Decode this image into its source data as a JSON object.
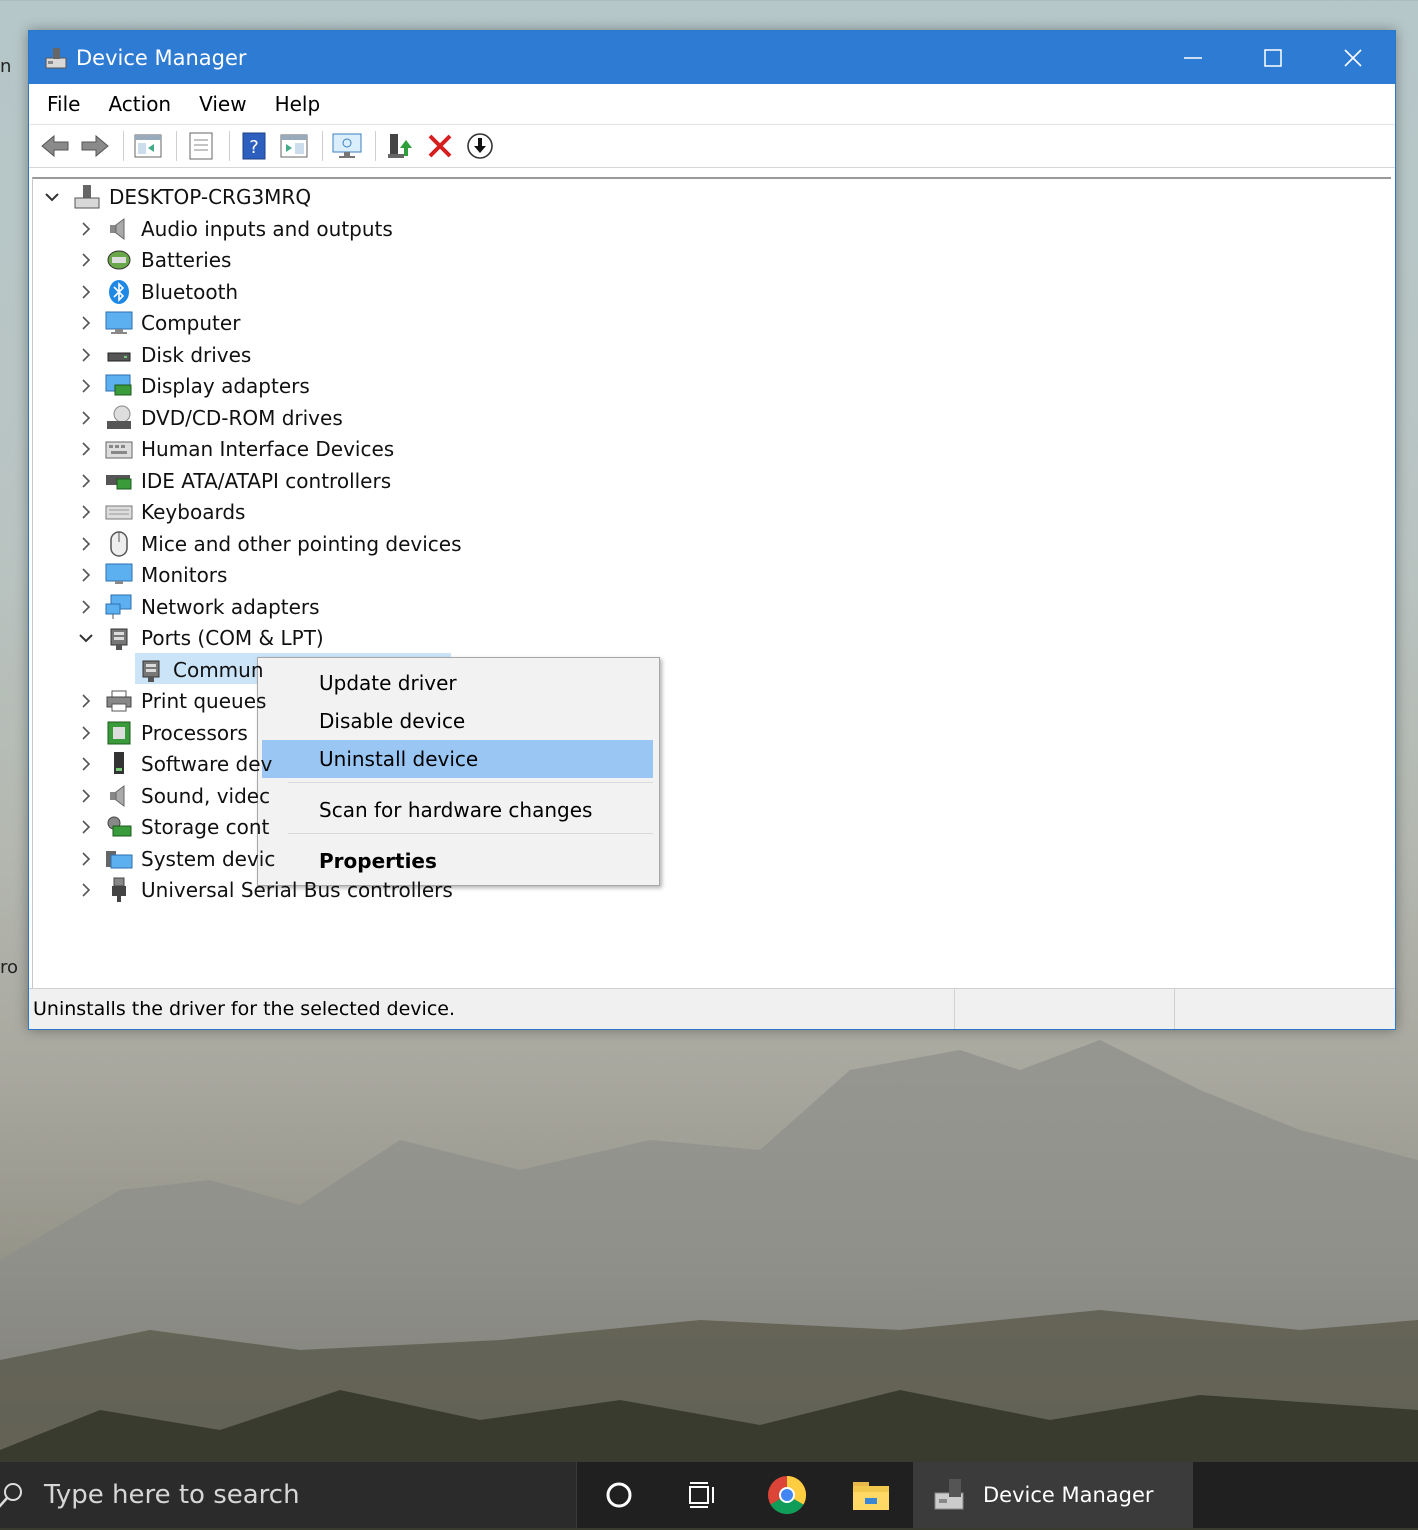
{
  "window": {
    "title": "Device Manager"
  },
  "menu": [
    "File",
    "Action",
    "View",
    "Help"
  ],
  "tree": {
    "root": "DESKTOP-CRG3MRQ",
    "categories": [
      {
        "label": "Audio inputs and outputs",
        "icon": "speaker-icon"
      },
      {
        "label": "Batteries",
        "icon": "battery-icon"
      },
      {
        "label": "Bluetooth",
        "icon": "bluetooth-icon"
      },
      {
        "label": "Computer",
        "icon": "computer-icon"
      },
      {
        "label": "Disk drives",
        "icon": "disk-drive-icon"
      },
      {
        "label": "Display adapters",
        "icon": "display-adapter-icon"
      },
      {
        "label": "DVD/CD-ROM drives",
        "icon": "dvd-drive-icon"
      },
      {
        "label": "Human Interface Devices",
        "icon": "hid-icon"
      },
      {
        "label": "IDE ATA/ATAPI controllers",
        "icon": "ide-controller-icon"
      },
      {
        "label": "Keyboards",
        "icon": "keyboard-icon"
      },
      {
        "label": "Mice and other pointing devices",
        "icon": "mouse-icon"
      },
      {
        "label": "Monitors",
        "icon": "monitor-icon"
      },
      {
        "label": "Network adapters",
        "icon": "network-adapter-icon"
      },
      {
        "label": "Ports (COM & LPT)",
        "icon": "port-icon"
      },
      {
        "label": "Commun",
        "icon": "port-icon"
      },
      {
        "label": "Print queues",
        "icon": "printer-icon"
      },
      {
        "label": "Processors",
        "icon": "processor-icon"
      },
      {
        "label": "Software dev",
        "icon": "software-device-icon"
      },
      {
        "label": "Sound, videc",
        "icon": "speaker-icon"
      },
      {
        "label": "Storage cont",
        "icon": "storage-controller-icon"
      },
      {
        "label": "System devic",
        "icon": "system-device-icon"
      },
      {
        "label": "Universal Serial Bus controllers",
        "icon": "usb-icon"
      }
    ]
  },
  "context_menu": {
    "items": [
      "Update driver",
      "Disable device",
      "Uninstall device",
      "Scan for hardware changes",
      "Properties"
    ],
    "highlighted": "Uninstall device"
  },
  "status": {
    "text": "Uninstalls the driver for the selected device."
  },
  "taskbar": {
    "search_placeholder": "Type here to search",
    "active_app": "Device Manager"
  },
  "desktop_edge": {
    "top_left": "n",
    "mid_left": "ro"
  }
}
